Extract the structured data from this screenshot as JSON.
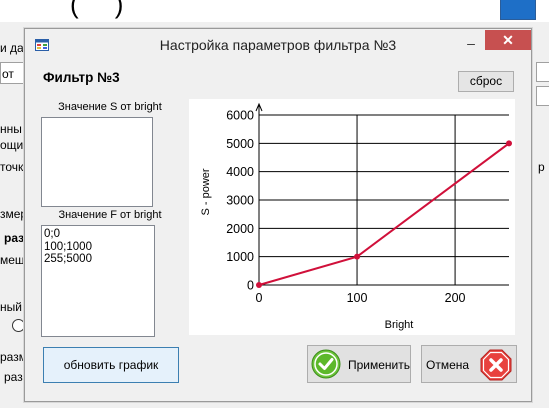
{
  "dialog": {
    "title": "Настройка параметров фильтра №3",
    "heading": "Фильтр №3",
    "reset_label": "сброс",
    "s_label": "Значение S от bright",
    "f_label": "Значение F от bright",
    "s_text": "",
    "f_text": "0;0\n100;1000\n255;5000",
    "update_label": "обновить график",
    "apply_label": "Применить",
    "cancel_label": "Отмена",
    "minimize_glyph": "–",
    "close_glyph": "✕"
  },
  "background": {
    "fragments": [
      "и да",
      "от",
      "нны",
      "ощий",
      "точк",
      "змер",
      "раз",
      "мещ",
      "ный",
      "р",
      "разм",
      "разм"
    ]
  },
  "colors": {
    "series": "#d0103a",
    "close_button": "#c75050",
    "apply_icon": "#5cb82a",
    "cancel_icon": "#e8423e"
  },
  "icons": [
    "app-icon",
    "minimize-icon",
    "close-icon",
    "check-icon",
    "x-icon"
  ],
  "chart_data": {
    "type": "line",
    "xlabel": "Bright",
    "ylabel": "S - power",
    "x_ticks": [
      0,
      100,
      200
    ],
    "y_ticks": [
      0,
      1000,
      2000,
      3000,
      4000,
      5000,
      6000
    ],
    "xlim": [
      0,
      255
    ],
    "ylim": [
      0,
      6000
    ],
    "grid": true,
    "series": [
      {
        "x": [
          0,
          100,
          255
        ],
        "y": [
          0,
          1000,
          5000
        ]
      }
    ]
  }
}
